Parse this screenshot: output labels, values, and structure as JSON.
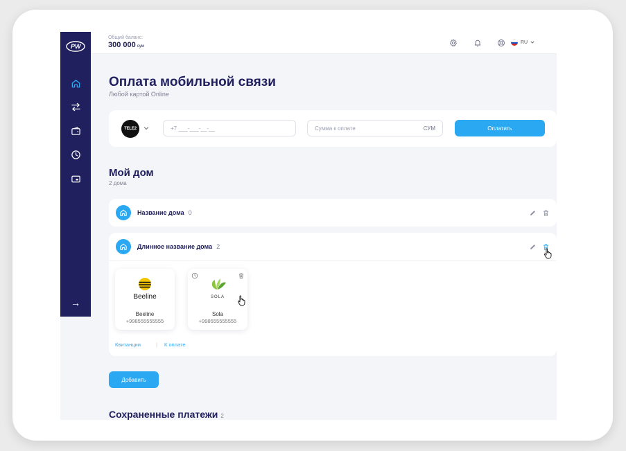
{
  "app": {
    "logo_text": "PW"
  },
  "sidebar": {
    "items": [
      {
        "name": "home",
        "active": true
      },
      {
        "name": "transfers"
      },
      {
        "name": "wallet"
      },
      {
        "name": "history"
      },
      {
        "name": "cards"
      }
    ],
    "collapse_arrow": "→"
  },
  "header": {
    "balance_label": "Общий баланс:",
    "balance_value": "300 000",
    "balance_currency": "сум",
    "language": "RU"
  },
  "payment": {
    "title": "Оплата мобильной связи",
    "subtitle": "Любой картой Online",
    "operator_label": "TELE2",
    "phone_placeholder": "+7 ___-___-__-__",
    "amount_placeholder": "Сумма к оплате",
    "amount_unit": "СУМ",
    "pay_button": "Оплатить"
  },
  "my_home": {
    "title": "Мой дом",
    "subtitle": "2 дома",
    "houses": [
      {
        "name": "Название дома",
        "count": "0"
      },
      {
        "name": "Длинное название дома",
        "count": "2",
        "services": [
          {
            "logo_text": "Beeline",
            "name": "Beeline",
            "phone": "+998555555555"
          },
          {
            "logo_text": "SOLA",
            "name": "Sola",
            "phone": "+998555555555"
          }
        ],
        "links": [
          "Квитанции",
          "К оплате"
        ],
        "link_separator": "|"
      }
    ],
    "add_button": "Добавить"
  },
  "saved_payments": {
    "title": "Сохраненные платежи",
    "count": "2"
  },
  "colors": {
    "accent": "#2aa8f1",
    "sidebar": "#21205f",
    "title": "#21205f"
  }
}
